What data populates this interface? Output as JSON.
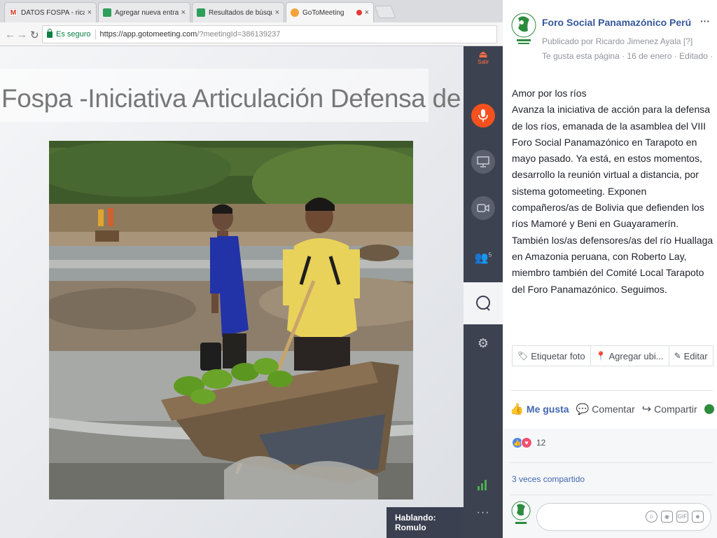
{
  "browser": {
    "tabs": [
      {
        "label": "DATOS FOSPA - ricardoj",
        "close": "×"
      },
      {
        "label": "Agregar nueva entrada ‹",
        "close": "×"
      },
      {
        "label": "Resultados de búsqueda",
        "close": "×"
      },
      {
        "label": "GoToMeeting",
        "close": "×"
      }
    ],
    "secure_label": "Es seguro",
    "url_host": "https://app.gotomeeting.com",
    "url_path": "/?meetingId=386139237"
  },
  "meeting": {
    "slide_title": "Fospa -Iniciativa Articulación Defensa de los Ríos",
    "exit_label": "Salir",
    "attendee_count": "5",
    "speaking": "Hablando: Romulo"
  },
  "facebook": {
    "page_name": "Foro Social Panamazónico Perú",
    "published_by": "Publicado por Ricardo Jimenez Ayala [?]",
    "meta": "Te gusta esta página · 16 de enero · Editado ·",
    "post_title": "Amor por los ríos",
    "post_body": "Avanza la iniciativa de acción para la defensa de los ríos, emanada de la asamblea del VIII Foro Social Panamazónico en Tarapoto en mayo pasado. Ya está, en estos momentos, desarrollo la reunión virtual a distancia, por sistema gotomeeting. Exponen compañeros/as de Bolivia que defienden los ríos Mamoré y Beni en Guayaramerín. También los/as defensores/as del río Huallaga en Amazonia peruana, con Roberto Lay, miembro también del Comité Local Tarapoto del Foro Panamazónico. Seguimos.",
    "photo_actions": [
      "Etiquetar foto",
      "Agregar ubi...",
      "Editar"
    ],
    "like_label": "Me gusta",
    "comment_label": "Comentar",
    "share_label": "Compartir",
    "reaction_count": "12",
    "shares": "3 veces compartido"
  },
  "colors": {
    "fb_blue": "#4267b2",
    "gtm_sidebar": "#3d4250",
    "gtm_orange": "#f4511e"
  }
}
